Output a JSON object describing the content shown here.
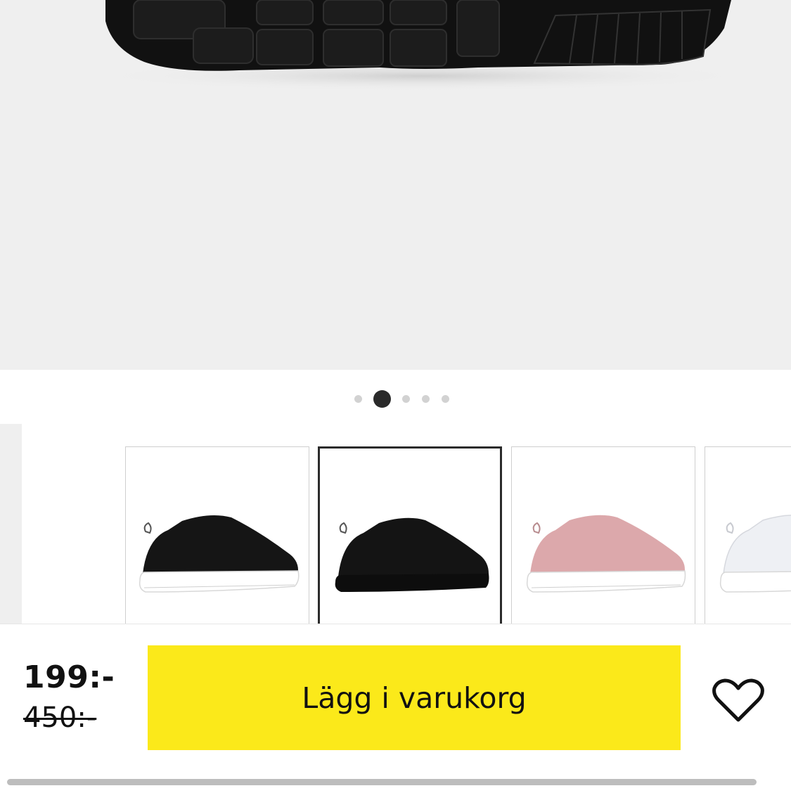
{
  "product_gallery": {
    "images": [
      "sole-bottom-view"
    ],
    "dots_count": 5,
    "active_index": 1
  },
  "variants": {
    "items": [
      {
        "name": "black-white-sole",
        "selected": false
      },
      {
        "name": "all-black",
        "selected": true
      },
      {
        "name": "pink",
        "selected": false
      },
      {
        "name": "white",
        "selected": false
      }
    ]
  },
  "purchase": {
    "price": "199:-",
    "original_price": "450:-",
    "add_to_cart_label": "Lägg i varukorg",
    "button_color": "#fbe91a"
  },
  "icons": {
    "wishlist": "heart-icon"
  }
}
